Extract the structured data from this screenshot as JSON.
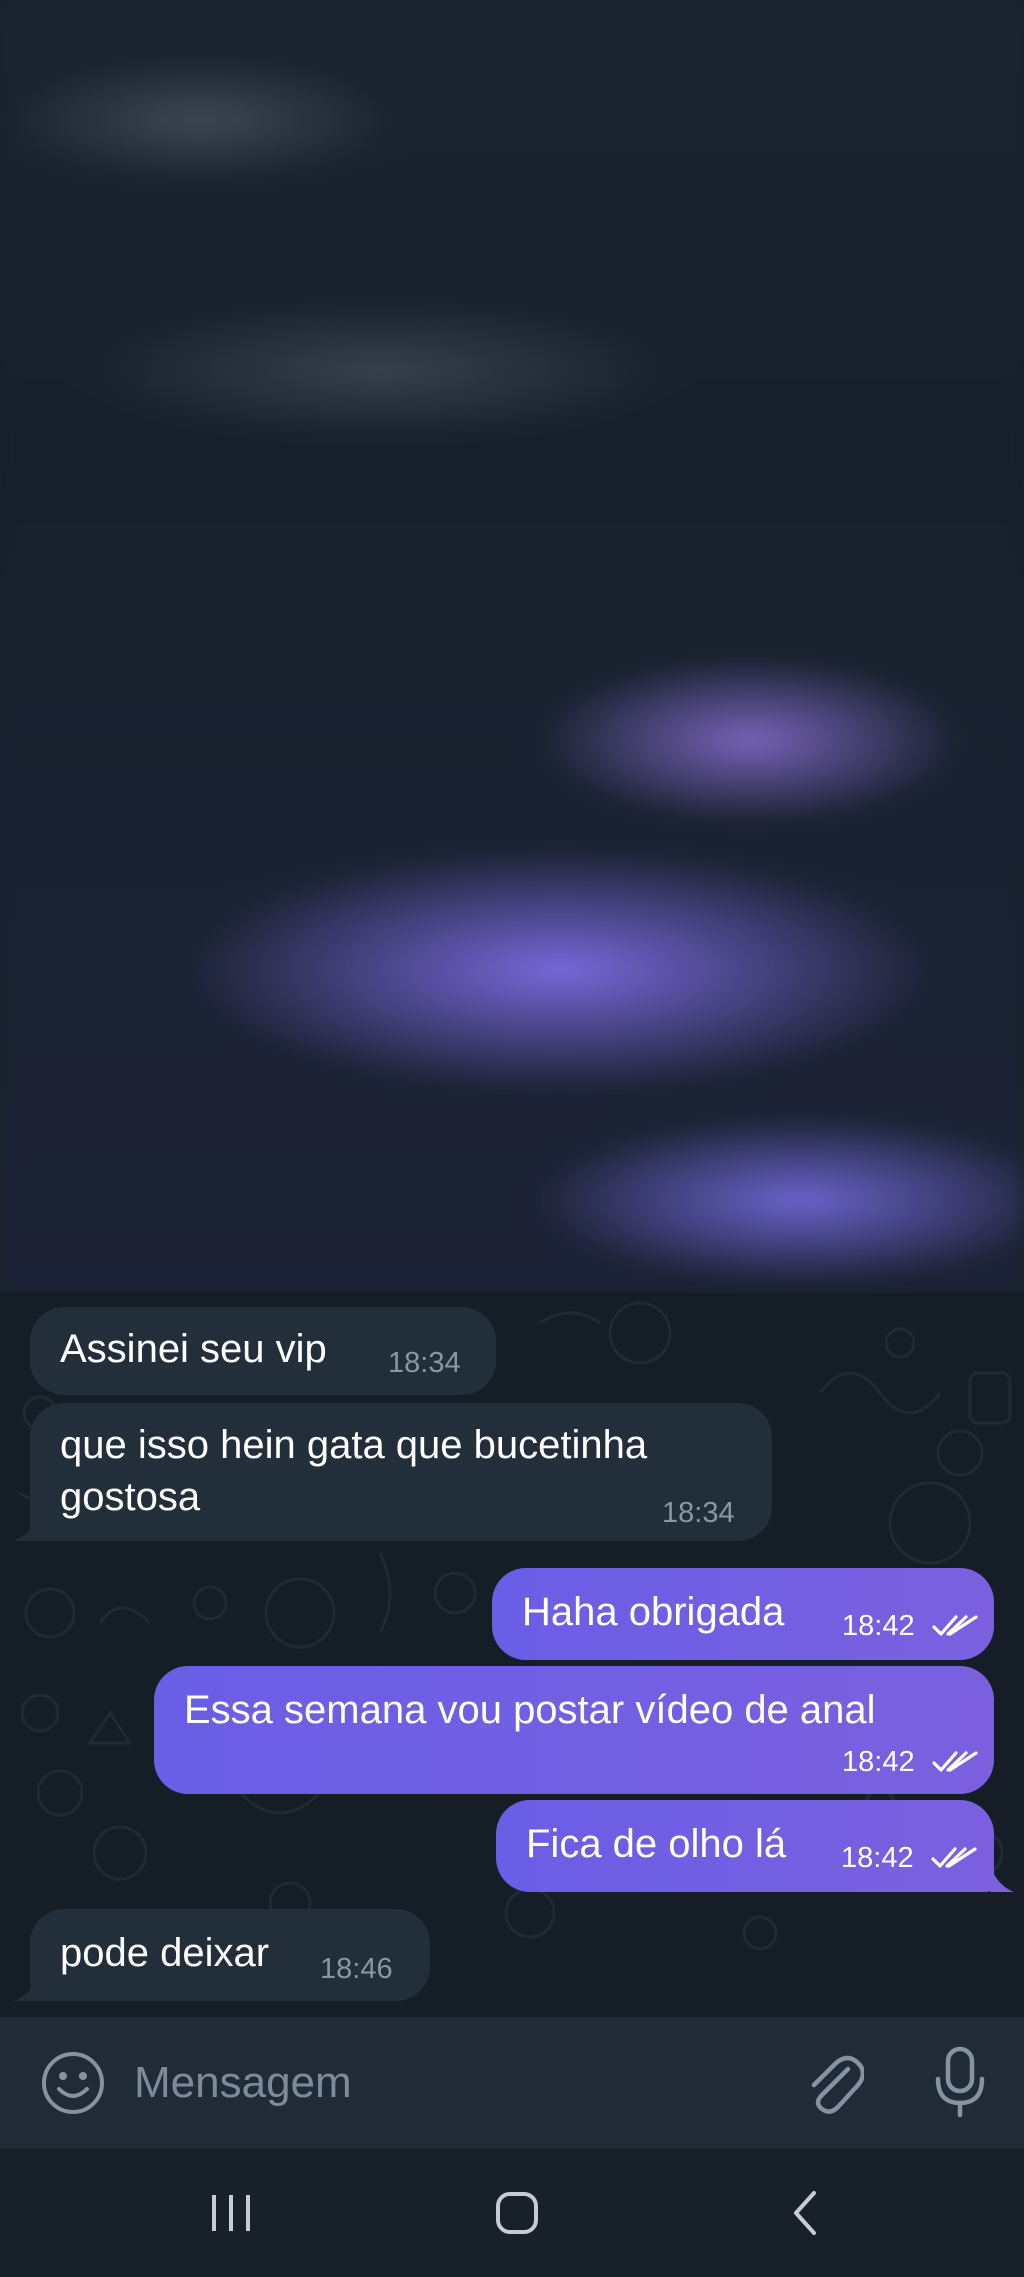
{
  "messages": [
    {
      "text": "Assinei seu vip",
      "time": "18:34",
      "direction": "incoming"
    },
    {
      "text": "que isso hein gata que bucetinha\ngostosa",
      "time": "18:34",
      "direction": "incoming"
    },
    {
      "text": "Haha obrigada",
      "time": "18:42",
      "direction": "outgoing",
      "status": "read"
    },
    {
      "text": "Essa semana vou postar vídeo de anal",
      "time": "18:42",
      "direction": "outgoing",
      "status": "read"
    },
    {
      "text": "Fica de olho lá",
      "time": "18:42",
      "direction": "outgoing",
      "status": "read"
    },
    {
      "text": "pode deixar",
      "time": "18:46",
      "direction": "incoming"
    }
  ],
  "composer": {
    "placeholder": "Mensagem",
    "emoji_icon": "smile-icon",
    "attach_icon": "paperclip-icon",
    "mic_icon": "microphone-icon"
  },
  "navigation": {
    "recents_icon": "recents-icon",
    "home_icon": "home-icon",
    "back_icon": "back-icon"
  },
  "colors": {
    "incoming_bubble": "#222e3a",
    "outgoing_bubble": "#6a5ee6",
    "background": "#17212b"
  }
}
